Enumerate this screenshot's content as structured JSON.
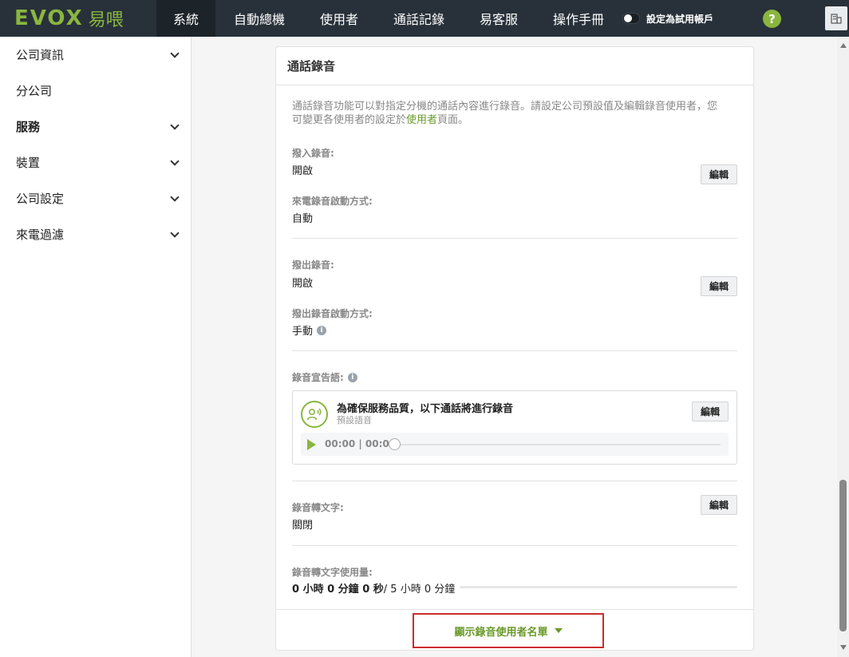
{
  "brand": {
    "logo_text": "EVOX",
    "logo_cn": "易喂"
  },
  "nav": {
    "items": [
      {
        "label": "系統"
      },
      {
        "label": "自動總機"
      },
      {
        "label": "使用者"
      },
      {
        "label": "通話記錄"
      },
      {
        "label": "易客服"
      },
      {
        "label": "操作手冊"
      }
    ],
    "trial_toggle_label": "設定為試用帳戶",
    "help_label": "?"
  },
  "sidebar": {
    "items": [
      {
        "label": "公司資訊"
      },
      {
        "label": "分公司"
      },
      {
        "label": "服務"
      },
      {
        "label": "裝置"
      },
      {
        "label": "公司設定"
      },
      {
        "label": "來電過濾"
      }
    ]
  },
  "card": {
    "title": "通話錄音",
    "description_prefix": "通話錄音功能可以對指定分機的通話內容進行錄音。請設定公司預設值及編輯錄音使用者，您可變更各使用者的設定於",
    "description_link": "使用者",
    "description_suffix": "頁面。",
    "inbound": {
      "label": "撥入錄音:",
      "value": "開啟",
      "trigger_label": "來電錄音啟動方式:",
      "trigger_value": "自動",
      "edit_label": "編輯"
    },
    "outbound": {
      "label": "撥出錄音:",
      "value": "開啟",
      "trigger_label": "撥出錄音啟動方式:",
      "trigger_value": "手動",
      "edit_label": "編輯"
    },
    "announcement": {
      "label": "錄音宣告語:",
      "title": "為確保服務品質，以下通話將進行錄音",
      "subtitle": "預設語音",
      "edit_label": "編輯",
      "time": "00:00 | 00:03"
    },
    "transcription": {
      "label": "錄音轉文字:",
      "value": "關閉",
      "edit_label": "編輯"
    },
    "usage": {
      "label": "錄音轉文字使用量:",
      "used": "0 小時 0 分鐘 0 秒",
      "total": "/ 5 小時 0 分鐘",
      "progress": 0
    },
    "show_list_label": "顯示錄音使用者名單"
  },
  "colors": {
    "accent": "#8ab63f",
    "topbar": "#28313a",
    "highlight_border": "#cc2b2b"
  }
}
